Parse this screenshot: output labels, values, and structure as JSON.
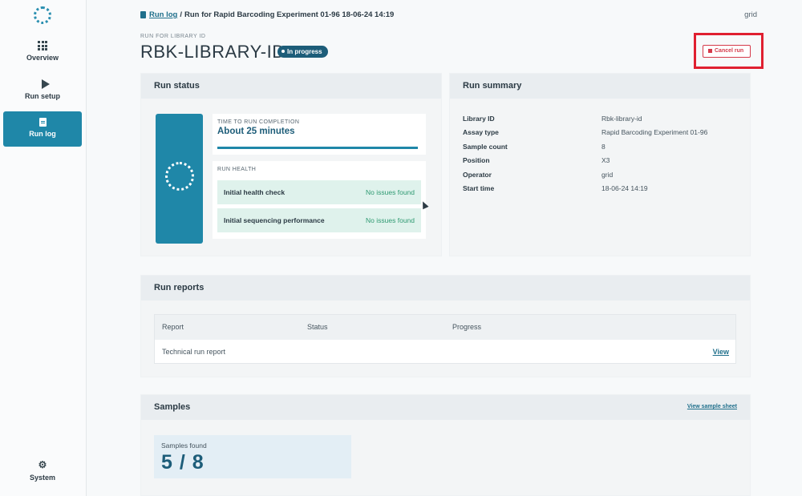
{
  "sidebar": {
    "items": [
      {
        "label": "Overview",
        "icon": "grid-icon"
      },
      {
        "label": "Run setup",
        "icon": "play-icon"
      },
      {
        "label": "Run log",
        "icon": "document-icon"
      }
    ],
    "system_label": "System"
  },
  "breadcrumb": {
    "root": "Run log",
    "separator": "/",
    "current": "Run for Rapid Barcoding Experiment 01-96 18-06-24 14:19"
  },
  "user_label": "grid",
  "header": {
    "kicker": "RUN FOR LIBRARY ID",
    "title": "RBK-LIBRARY-ID",
    "status_badge": "In progress",
    "cancel_label": "Cancel run"
  },
  "run_status": {
    "title": "Run status",
    "completion_label": "TIME TO RUN COMPLETION",
    "completion_value": "About 25 minutes",
    "health_label": "RUN HEALTH",
    "checks": [
      {
        "name": "Initial health check",
        "status": "No issues found"
      },
      {
        "name": "Initial sequencing performance",
        "status": "No issues found"
      }
    ]
  },
  "run_summary": {
    "title": "Run summary",
    "rows": [
      {
        "key": "Library ID",
        "value": "Rbk-library-id"
      },
      {
        "key": "Assay type",
        "value": "Rapid Barcoding Experiment 01-96"
      },
      {
        "key": "Sample count",
        "value": "8"
      },
      {
        "key": "Position",
        "value": "X3"
      },
      {
        "key": "Operator",
        "value": "grid"
      },
      {
        "key": "Start time",
        "value": "18-06-24 14:19"
      }
    ]
  },
  "run_reports": {
    "title": "Run reports",
    "columns": [
      "Report",
      "Status",
      "Progress"
    ],
    "rows": [
      {
        "report": "Technical run report",
        "action": "View"
      }
    ]
  },
  "samples": {
    "title": "Samples",
    "link": "View sample sheet",
    "found_label": "Samples found",
    "found_value": "5 / 8"
  },
  "colors": {
    "accent": "#1f87a8",
    "danger": "#d53a4a",
    "success": "#2f9a72"
  }
}
